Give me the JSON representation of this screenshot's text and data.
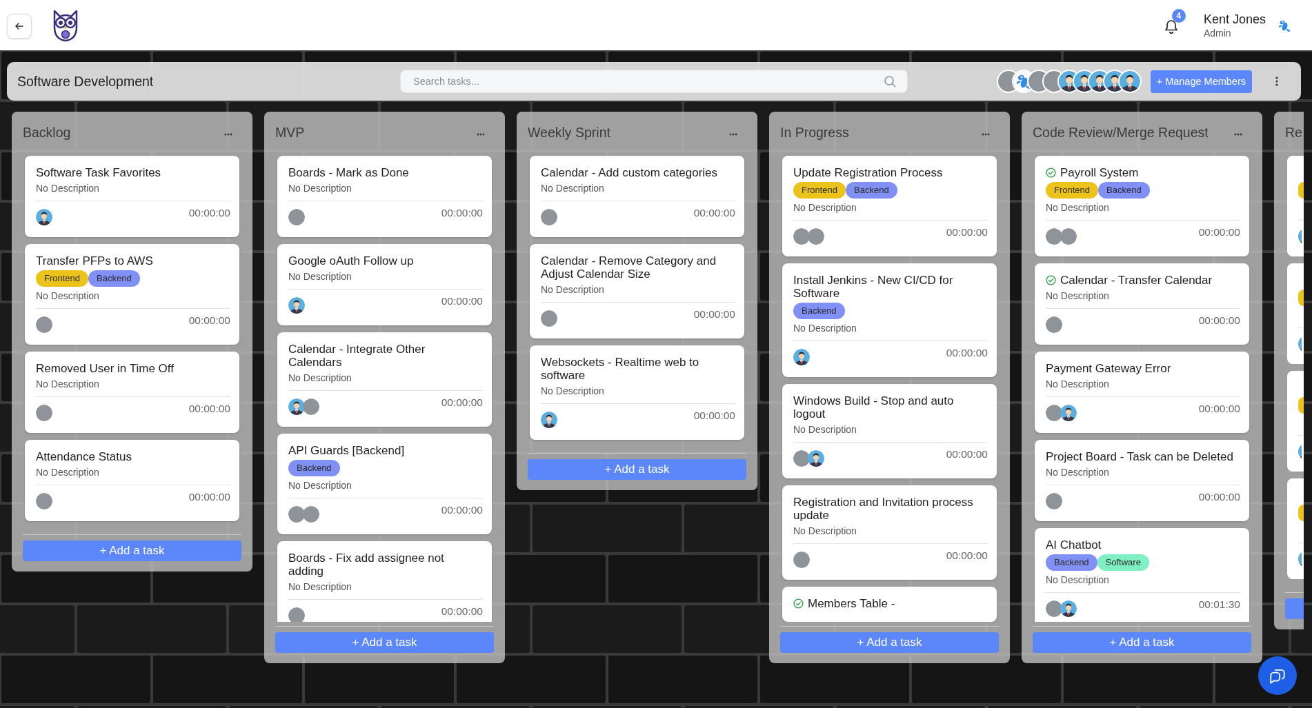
{
  "header": {
    "notifications": {
      "count": "4"
    },
    "user": {
      "name": "Kent Jones",
      "role": "Admin",
      "avatar": {
        "kind": "mascot"
      }
    }
  },
  "board": {
    "title": "Software Development",
    "search": {
      "placeholder": "Search tasks..."
    },
    "members": [
      {
        "kind": "photo"
      },
      {
        "kind": "mascot"
      },
      {
        "kind": "photo"
      },
      {
        "kind": "photo"
      },
      {
        "kind": "default"
      },
      {
        "kind": "default"
      },
      {
        "kind": "default"
      },
      {
        "kind": "default"
      },
      {
        "kind": "default"
      }
    ],
    "manage_button": "+ Manage Members"
  },
  "columns": [
    {
      "title": "Backlog",
      "kind": "full",
      "cards": [
        {
          "title": "Software Task Favorites",
          "done": false,
          "description": "No Description",
          "assignees": [
            {
              "kind": "default"
            }
          ],
          "time": "00:00:00"
        },
        {
          "title": "Transfer PFPs to AWS",
          "done": false,
          "tags": [
            {
              "label": "Frontend",
              "color": "#ebc31a"
            },
            {
              "label": "Backend",
              "color": "#8090f4"
            }
          ],
          "description": "No Description",
          "assignees": [
            {
              "kind": "photo"
            }
          ],
          "time": "00:00:00"
        },
        {
          "title": "Removed User in Time Off",
          "done": false,
          "description": "No Description",
          "assignees": [
            {
              "kind": "photo"
            }
          ],
          "time": "00:00:00"
        },
        {
          "title": "Attendance Status",
          "done": false,
          "description": "No Description",
          "assignees": [
            {
              "kind": "photo"
            }
          ],
          "time": "00:00:00"
        }
      ],
      "add_button": "+ Add a task"
    },
    {
      "title": "MVP",
      "kind": "full",
      "cards": [
        {
          "title": "Boards - Mark as Done",
          "done": false,
          "description": "No Description",
          "assignees": [
            {
              "kind": "photo"
            }
          ],
          "time": "00:00:00"
        },
        {
          "title": "Google oAuth Follow up",
          "done": false,
          "description": "No Description",
          "assignees": [
            {
              "kind": "default"
            }
          ],
          "time": "00:00:00"
        },
        {
          "title": "Calendar - Integrate Other Calendars",
          "done": false,
          "description": "No Description",
          "assignees": [
            {
              "kind": "default"
            },
            {
              "kind": "photo"
            }
          ],
          "time": "00:00:00"
        },
        {
          "title": "API Guards [Backend]",
          "done": false,
          "tags": [
            {
              "label": "Backend",
              "color": "#8090f4"
            }
          ],
          "description": "No Description",
          "assignees": [
            {
              "kind": "photo"
            },
            {
              "kind": "photo"
            }
          ],
          "time": "00:00:00"
        },
        {
          "title": "Boards - Fix add assignee not adding",
          "done": false,
          "description": "No Description",
          "assignees": [
            {
              "kind": "photo"
            }
          ],
          "time": "00:00:00"
        }
      ],
      "add_button": "+ Add a task"
    },
    {
      "title": "Weekly Sprint",
      "kind": "full",
      "cards": [
        {
          "title": "Calendar - Add custom categories",
          "done": false,
          "description": "No Description",
          "assignees": [
            {
              "kind": "photo"
            }
          ],
          "time": "00:00:00"
        },
        {
          "title": "Calendar - Remove Category and Adjust Calendar Size",
          "done": false,
          "description": "No Description",
          "assignees": [
            {
              "kind": "photo"
            }
          ],
          "time": "00:00:00"
        },
        {
          "title": "Websockets - Realtime web to software",
          "done": false,
          "description": "No Description",
          "assignees": [
            {
              "kind": "default"
            }
          ],
          "time": "00:00:00"
        }
      ],
      "add_button": "+ Add a task"
    },
    {
      "title": "In Progress",
      "kind": "full",
      "cards": [
        {
          "title": "Update Registration Process",
          "done": false,
          "tags": [
            {
              "label": "Frontend",
              "color": "#ebc31a"
            },
            {
              "label": "Backend",
              "color": "#8090f4"
            }
          ],
          "description": "No Description",
          "assignees": [
            {
              "kind": "photo"
            },
            {
              "kind": "photo"
            }
          ],
          "time": "00:00:00"
        },
        {
          "title": "Install Jenkins - New CI/CD for Software",
          "done": false,
          "tags": [
            {
              "label": "Backend",
              "color": "#8090f4"
            }
          ],
          "description": "No Description",
          "assignees": [
            {
              "kind": "default"
            }
          ],
          "time": "00:00:00"
        },
        {
          "title": "Windows Build - Stop and auto logout",
          "done": false,
          "description": "No Description",
          "assignees": [
            {
              "kind": "photo"
            },
            {
              "kind": "default"
            }
          ],
          "time": "00:00:00"
        },
        {
          "title": "Registration and Invitation process update",
          "done": false,
          "description": "No Description",
          "assignees": [
            {
              "kind": "photo"
            }
          ],
          "time": "00:00:00"
        },
        {
          "title": "Members Table -",
          "done": true
        }
      ],
      "add_button": "+ Add a task"
    },
    {
      "title": "Code Review/Merge Request",
      "kind": "full",
      "cards": [
        {
          "title": "Payroll System",
          "done": true,
          "tags": [
            {
              "label": "Frontend",
              "color": "#ebc31a"
            },
            {
              "label": "Backend",
              "color": "#8090f4"
            }
          ],
          "description": "No Description",
          "assignees": [
            {
              "kind": "photo"
            },
            {
              "kind": "photo"
            }
          ],
          "time": "00:00:00"
        },
        {
          "title": "Calendar - Transfer Calendar",
          "done": true,
          "description": "No Description",
          "assignees": [
            {
              "kind": "photo"
            }
          ],
          "time": "00:00:00"
        },
        {
          "title": "Payment Gateway Error",
          "done": false,
          "description": "No Description",
          "assignees": [
            {
              "kind": "photo"
            },
            {
              "kind": "default"
            }
          ],
          "time": "00:00:00"
        },
        {
          "title": "Project Board - Task can be Deleted",
          "done": false,
          "description": "No Description",
          "assignees": [
            {
              "kind": "photo"
            }
          ],
          "time": "00:00:00"
        },
        {
          "title": "AI Chatbot",
          "done": false,
          "tags": [
            {
              "label": "Backend",
              "color": "#8090f4"
            },
            {
              "label": "Software",
              "color": "#7ff0c2"
            }
          ],
          "description": "No Description",
          "assignees": [
            {
              "kind": "photo"
            },
            {
              "kind": "default"
            }
          ],
          "time": "00:01:30"
        }
      ],
      "add_button": "+ Add a task"
    },
    {
      "title": "Re",
      "kind": "partial",
      "cards": [
        {
          "tags": [
            {
              "color": "#ebc31a"
            }
          ],
          "assignees": [
            {
              "kind": "default"
            }
          ]
        },
        {
          "tags": [
            {
              "color": "#ebc31a"
            }
          ],
          "assignees": [
            {
              "kind": "default"
            }
          ]
        },
        {
          "tags": [
            {
              "color": "#ebc31a"
            }
          ],
          "assignees": [
            {
              "kind": "default"
            }
          ]
        },
        {
          "tags": [
            {
              "color": "#ebc31a"
            }
          ],
          "assignees": [
            {
              "kind": "default"
            }
          ]
        }
      ]
    }
  ]
}
